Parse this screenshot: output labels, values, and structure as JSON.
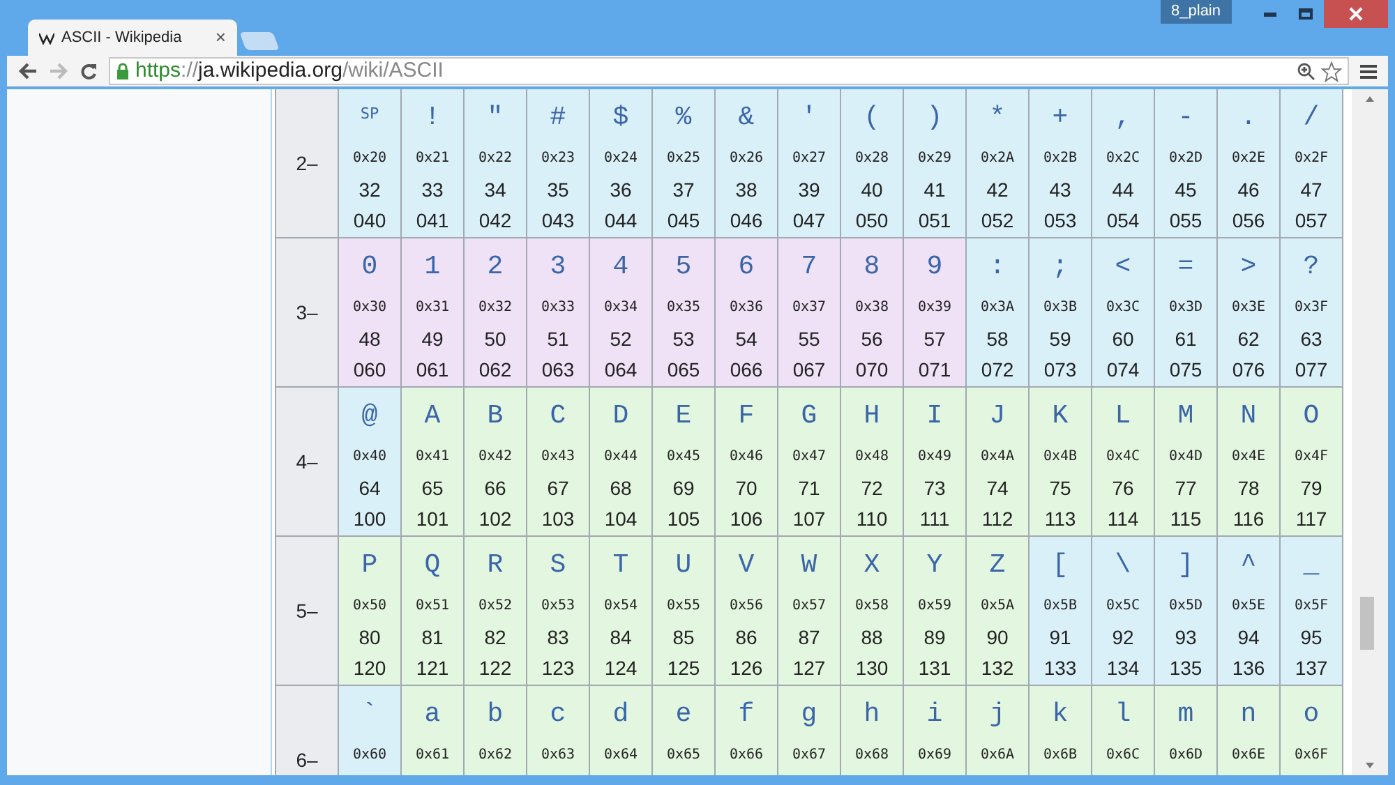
{
  "window": {
    "badge": "8_plain"
  },
  "tabs": [
    {
      "title": "ASCII - Wikipedia",
      "selected": true,
      "close": "×"
    }
  ],
  "address_bar": {
    "url_parts": [
      {
        "text": "https",
        "kind": "scheme"
      },
      {
        "text": "://",
        "kind": "punct"
      },
      {
        "text": "ja.wikipedia.org",
        "kind": "host"
      },
      {
        "text": "/wiki/ASCII",
        "kind": "path"
      }
    ]
  },
  "table": {
    "rows": [
      {
        "label": "2–",
        "cells": [
          {
            "char": "SP",
            "kind": "abbr",
            "hex": "0x20",
            "dec": "32",
            "oct": "040",
            "color": "#daf0f9"
          },
          {
            "char": "!",
            "kind": "char",
            "hex": "0x21",
            "dec": "33",
            "oct": "041",
            "color": "#daf0f9"
          },
          {
            "char": "\"",
            "kind": "char",
            "hex": "0x22",
            "dec": "34",
            "oct": "042",
            "color": "#daf0f9"
          },
          {
            "char": "#",
            "kind": "char",
            "hex": "0x23",
            "dec": "35",
            "oct": "043",
            "color": "#daf0f9"
          },
          {
            "char": "$",
            "kind": "char",
            "hex": "0x24",
            "dec": "36",
            "oct": "044",
            "color": "#daf0f9"
          },
          {
            "char": "%",
            "kind": "char",
            "hex": "0x25",
            "dec": "37",
            "oct": "045",
            "color": "#daf0f9"
          },
          {
            "char": "&",
            "kind": "char",
            "hex": "0x26",
            "dec": "38",
            "oct": "046",
            "color": "#daf0f9"
          },
          {
            "char": "'",
            "kind": "char",
            "hex": "0x27",
            "dec": "39",
            "oct": "047",
            "color": "#daf0f9"
          },
          {
            "char": "(",
            "kind": "char",
            "hex": "0x28",
            "dec": "40",
            "oct": "050",
            "color": "#daf0f9"
          },
          {
            "char": ")",
            "kind": "char",
            "hex": "0x29",
            "dec": "41",
            "oct": "051",
            "color": "#daf0f9"
          },
          {
            "char": "*",
            "kind": "char",
            "hex": "0x2A",
            "dec": "42",
            "oct": "052",
            "color": "#daf0f9"
          },
          {
            "char": "+",
            "kind": "char",
            "hex": "0x2B",
            "dec": "43",
            "oct": "053",
            "color": "#daf0f9"
          },
          {
            "char": ",",
            "kind": "char",
            "hex": "0x2C",
            "dec": "44",
            "oct": "054",
            "color": "#daf0f9"
          },
          {
            "char": "-",
            "kind": "char",
            "hex": "0x2D",
            "dec": "45",
            "oct": "055",
            "color": "#daf0f9"
          },
          {
            "char": ".",
            "kind": "char",
            "hex": "0x2E",
            "dec": "46",
            "oct": "056",
            "color": "#daf0f9"
          },
          {
            "char": "/",
            "kind": "char",
            "hex": "0x2F",
            "dec": "47",
            "oct": "057",
            "color": "#daf0f9"
          }
        ]
      },
      {
        "label": "3–",
        "cells": [
          {
            "char": "0",
            "kind": "char",
            "hex": "0x30",
            "dec": "48",
            "oct": "060",
            "color": "#efe1f6"
          },
          {
            "char": "1",
            "kind": "char",
            "hex": "0x31",
            "dec": "49",
            "oct": "061",
            "color": "#efe1f6"
          },
          {
            "char": "2",
            "kind": "char",
            "hex": "0x32",
            "dec": "50",
            "oct": "062",
            "color": "#efe1f6"
          },
          {
            "char": "3",
            "kind": "char",
            "hex": "0x33",
            "dec": "51",
            "oct": "063",
            "color": "#efe1f6"
          },
          {
            "char": "4",
            "kind": "char",
            "hex": "0x34",
            "dec": "52",
            "oct": "064",
            "color": "#efe1f6"
          },
          {
            "char": "5",
            "kind": "char",
            "hex": "0x35",
            "dec": "53",
            "oct": "065",
            "color": "#efe1f6"
          },
          {
            "char": "6",
            "kind": "char",
            "hex": "0x36",
            "dec": "54",
            "oct": "066",
            "color": "#efe1f6"
          },
          {
            "char": "7",
            "kind": "char",
            "hex": "0x37",
            "dec": "55",
            "oct": "067",
            "color": "#efe1f6"
          },
          {
            "char": "8",
            "kind": "char",
            "hex": "0x38",
            "dec": "56",
            "oct": "070",
            "color": "#efe1f6"
          },
          {
            "char": "9",
            "kind": "char",
            "hex": "0x39",
            "dec": "57",
            "oct": "071",
            "color": "#efe1f6"
          },
          {
            "char": ":",
            "kind": "char",
            "hex": "0x3A",
            "dec": "58",
            "oct": "072",
            "color": "#daf0f9"
          },
          {
            "char": ";",
            "kind": "char",
            "hex": "0x3B",
            "dec": "59",
            "oct": "073",
            "color": "#daf0f9"
          },
          {
            "char": "<",
            "kind": "char",
            "hex": "0x3C",
            "dec": "60",
            "oct": "074",
            "color": "#daf0f9"
          },
          {
            "char": "=",
            "kind": "char",
            "hex": "0x3D",
            "dec": "61",
            "oct": "075",
            "color": "#daf0f9"
          },
          {
            "char": ">",
            "kind": "char",
            "hex": "0x3E",
            "dec": "62",
            "oct": "076",
            "color": "#daf0f9"
          },
          {
            "char": "?",
            "kind": "char",
            "hex": "0x3F",
            "dec": "63",
            "oct": "077",
            "color": "#daf0f9"
          }
        ]
      },
      {
        "label": "4–",
        "cells": [
          {
            "char": "@",
            "kind": "char",
            "hex": "0x40",
            "dec": "64",
            "oct": "100",
            "color": "#daf0f9"
          },
          {
            "char": "A",
            "kind": "char",
            "hex": "0x41",
            "dec": "65",
            "oct": "101",
            "color": "#e3f6df"
          },
          {
            "char": "B",
            "kind": "char",
            "hex": "0x42",
            "dec": "66",
            "oct": "102",
            "color": "#e3f6df"
          },
          {
            "char": "C",
            "kind": "char",
            "hex": "0x43",
            "dec": "67",
            "oct": "103",
            "color": "#e3f6df"
          },
          {
            "char": "D",
            "kind": "char",
            "hex": "0x44",
            "dec": "68",
            "oct": "104",
            "color": "#e3f6df"
          },
          {
            "char": "E",
            "kind": "char",
            "hex": "0x45",
            "dec": "69",
            "oct": "105",
            "color": "#e3f6df"
          },
          {
            "char": "F",
            "kind": "char",
            "hex": "0x46",
            "dec": "70",
            "oct": "106",
            "color": "#e3f6df"
          },
          {
            "char": "G",
            "kind": "char",
            "hex": "0x47",
            "dec": "71",
            "oct": "107",
            "color": "#e3f6df"
          },
          {
            "char": "H",
            "kind": "char",
            "hex": "0x48",
            "dec": "72",
            "oct": "110",
            "color": "#e3f6df"
          },
          {
            "char": "I",
            "kind": "char",
            "hex": "0x49",
            "dec": "73",
            "oct": "111",
            "color": "#e3f6df"
          },
          {
            "char": "J",
            "kind": "char",
            "hex": "0x4A",
            "dec": "74",
            "oct": "112",
            "color": "#e3f6df"
          },
          {
            "char": "K",
            "kind": "char",
            "hex": "0x4B",
            "dec": "75",
            "oct": "113",
            "color": "#e3f6df"
          },
          {
            "char": "L",
            "kind": "char",
            "hex": "0x4C",
            "dec": "76",
            "oct": "114",
            "color": "#e3f6df"
          },
          {
            "char": "M",
            "kind": "char",
            "hex": "0x4D",
            "dec": "77",
            "oct": "115",
            "color": "#e3f6df"
          },
          {
            "char": "N",
            "kind": "char",
            "hex": "0x4E",
            "dec": "78",
            "oct": "116",
            "color": "#e3f6df"
          },
          {
            "char": "O",
            "kind": "char",
            "hex": "0x4F",
            "dec": "79",
            "oct": "117",
            "color": "#e3f6df"
          }
        ]
      },
      {
        "label": "5–",
        "cells": [
          {
            "char": "P",
            "kind": "char",
            "hex": "0x50",
            "dec": "80",
            "oct": "120",
            "color": "#e3f6df"
          },
          {
            "char": "Q",
            "kind": "char",
            "hex": "0x51",
            "dec": "81",
            "oct": "121",
            "color": "#e3f6df"
          },
          {
            "char": "R",
            "kind": "char",
            "hex": "0x52",
            "dec": "82",
            "oct": "122",
            "color": "#e3f6df"
          },
          {
            "char": "S",
            "kind": "char",
            "hex": "0x53",
            "dec": "83",
            "oct": "123",
            "color": "#e3f6df"
          },
          {
            "char": "T",
            "kind": "char",
            "hex": "0x54",
            "dec": "84",
            "oct": "124",
            "color": "#e3f6df"
          },
          {
            "char": "U",
            "kind": "char",
            "hex": "0x55",
            "dec": "85",
            "oct": "125",
            "color": "#e3f6df"
          },
          {
            "char": "V",
            "kind": "char",
            "hex": "0x56",
            "dec": "86",
            "oct": "126",
            "color": "#e3f6df"
          },
          {
            "char": "W",
            "kind": "char",
            "hex": "0x57",
            "dec": "87",
            "oct": "127",
            "color": "#e3f6df"
          },
          {
            "char": "X",
            "kind": "char",
            "hex": "0x58",
            "dec": "88",
            "oct": "130",
            "color": "#e3f6df"
          },
          {
            "char": "Y",
            "kind": "char",
            "hex": "0x59",
            "dec": "89",
            "oct": "131",
            "color": "#e3f6df"
          },
          {
            "char": "Z",
            "kind": "char",
            "hex": "0x5A",
            "dec": "90",
            "oct": "132",
            "color": "#e3f6df"
          },
          {
            "char": "[",
            "kind": "char",
            "hex": "0x5B",
            "dec": "91",
            "oct": "133",
            "color": "#daf0f9"
          },
          {
            "char": "\\",
            "kind": "char",
            "hex": "0x5C",
            "dec": "92",
            "oct": "134",
            "color": "#daf0f9"
          },
          {
            "char": "]",
            "kind": "char",
            "hex": "0x5D",
            "dec": "93",
            "oct": "135",
            "color": "#daf0f9"
          },
          {
            "char": "^",
            "kind": "char",
            "hex": "0x5E",
            "dec": "94",
            "oct": "136",
            "color": "#daf0f9"
          },
          {
            "char": "_",
            "kind": "char",
            "hex": "0x5F",
            "dec": "95",
            "oct": "137",
            "color": "#daf0f9"
          }
        ]
      },
      {
        "label": "6–",
        "cells": [
          {
            "char": "`",
            "kind": "char",
            "hex": "0x60",
            "color": "#daf0f9"
          },
          {
            "char": "a",
            "kind": "char",
            "hex": "0x61",
            "color": "#e3f6df"
          },
          {
            "char": "b",
            "kind": "char",
            "hex": "0x62",
            "color": "#e3f6df"
          },
          {
            "char": "c",
            "kind": "char",
            "hex": "0x63",
            "color": "#e3f6df"
          },
          {
            "char": "d",
            "kind": "char",
            "hex": "0x64",
            "color": "#e3f6df"
          },
          {
            "char": "e",
            "kind": "char",
            "hex": "0x65",
            "color": "#e3f6df"
          },
          {
            "char": "f",
            "kind": "char",
            "hex": "0x66",
            "color": "#e3f6df"
          },
          {
            "char": "g",
            "kind": "char",
            "hex": "0x67",
            "color": "#e3f6df"
          },
          {
            "char": "h",
            "kind": "char",
            "hex": "0x68",
            "color": "#e3f6df"
          },
          {
            "char": "i",
            "kind": "char",
            "hex": "0x69",
            "color": "#e3f6df"
          },
          {
            "char": "j",
            "kind": "char",
            "hex": "0x6A",
            "color": "#e3f6df"
          },
          {
            "char": "k",
            "kind": "char",
            "hex": "0x6B",
            "color": "#e3f6df"
          },
          {
            "char": "l",
            "kind": "char",
            "hex": "0x6C",
            "color": "#e3f6df"
          },
          {
            "char": "m",
            "kind": "char",
            "hex": "0x6D",
            "color": "#e3f6df"
          },
          {
            "char": "n",
            "kind": "char",
            "hex": "0x6E",
            "color": "#e3f6df"
          },
          {
            "char": "o",
            "kind": "char",
            "hex": "0x6F",
            "color": "#e3f6df"
          }
        ]
      }
    ]
  }
}
